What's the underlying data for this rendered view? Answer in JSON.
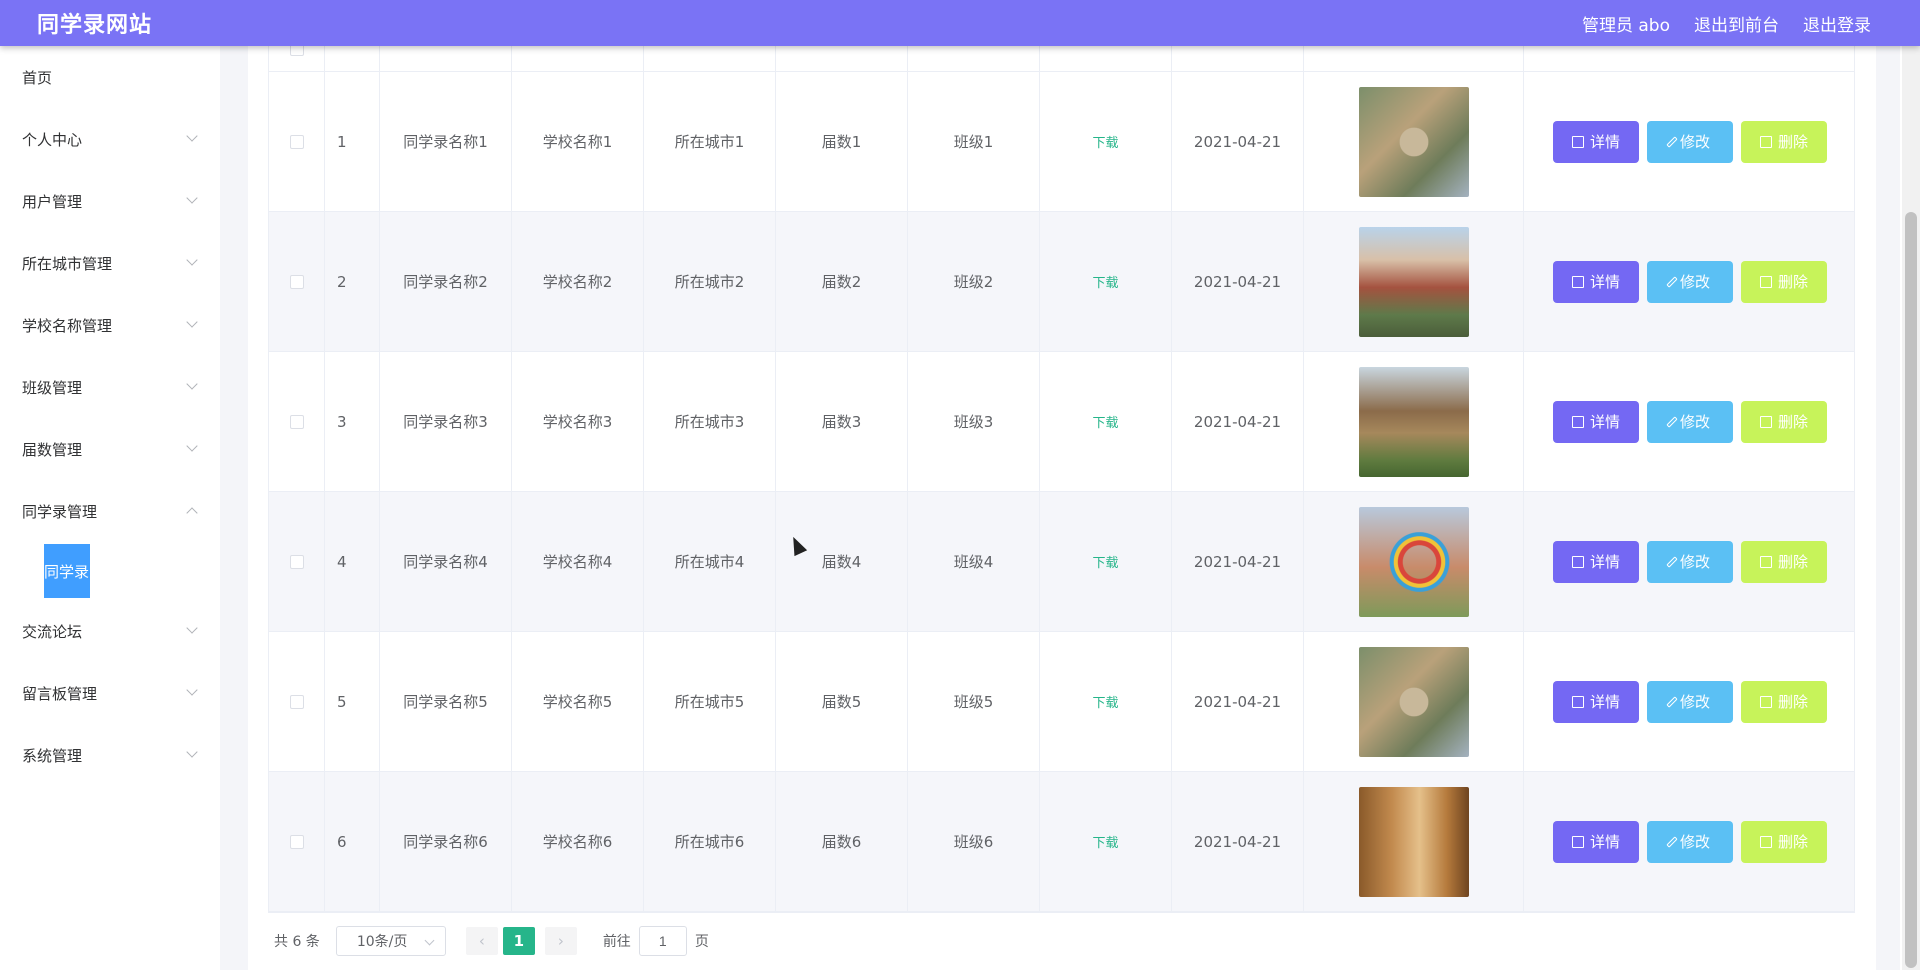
{
  "header": {
    "title": "同学录网站",
    "admin_label": "管理员 abo",
    "front_label": "退出到前台",
    "logout_label": "退出登录"
  },
  "sidebar": {
    "items": [
      {
        "label": "首页",
        "expandable": false
      },
      {
        "label": "个人中心",
        "expandable": true
      },
      {
        "label": "用户管理",
        "expandable": true
      },
      {
        "label": "所在城市管理",
        "expandable": true
      },
      {
        "label": "学校名称管理",
        "expandable": true
      },
      {
        "label": "班级管理",
        "expandable": true
      },
      {
        "label": "届数管理",
        "expandable": true
      },
      {
        "label": "同学录管理",
        "expandable": true,
        "expanded": true
      },
      {
        "label": "交流论坛",
        "expandable": true
      },
      {
        "label": "留言板管理",
        "expandable": true
      },
      {
        "label": "系统管理",
        "expandable": true
      }
    ],
    "submenu_active": "同学录"
  },
  "table": {
    "rows": [
      {
        "index": "1",
        "name": "同学录名称1",
        "school": "学校名称1",
        "city": "所在城市1",
        "year": "届数1",
        "class": "班级1",
        "download": "下载",
        "date": "2021-04-21",
        "image": "campus-aerial-image"
      },
      {
        "index": "2",
        "name": "同学录名称2",
        "school": "学校名称2",
        "city": "所在城市2",
        "year": "届数2",
        "class": "班级2",
        "download": "下载",
        "date": "2021-04-21",
        "image": "school-building-image"
      },
      {
        "index": "3",
        "name": "同学录名称3",
        "school": "学校名称3",
        "city": "所在城市3",
        "year": "届数3",
        "class": "班级3",
        "download": "下载",
        "date": "2021-04-21",
        "image": "pavilion-image"
      },
      {
        "index": "4",
        "name": "同学录名称4",
        "school": "学校名称4",
        "city": "所在城市4",
        "year": "届数4",
        "class": "班级4",
        "download": "下载",
        "date": "2021-04-21",
        "image": "sculpture-image"
      },
      {
        "index": "5",
        "name": "同学录名称5",
        "school": "学校名称5",
        "city": "所在城市5",
        "year": "届数5",
        "class": "班级5",
        "download": "下载",
        "date": "2021-04-21",
        "image": "campus-aerial-image"
      },
      {
        "index": "6",
        "name": "同学录名称6",
        "school": "学校名称6",
        "city": "所在城市6",
        "year": "届数6",
        "class": "班级6",
        "download": "下载",
        "date": "2021-04-21",
        "image": "dorm-room-image"
      }
    ],
    "actions": {
      "detail": "详情",
      "edit": "修改",
      "delete": "删除"
    }
  },
  "pagination": {
    "total_label": "共 6 条",
    "page_size": "10条/页",
    "prev_icon": "chevron-left-icon",
    "next_icon": "chevron-right-icon",
    "current_page": "1",
    "goto_prefix": "前往",
    "goto_value": "1",
    "goto_suffix": "页"
  },
  "colors": {
    "header": "#7a73f5",
    "detail_button": "#7468f3",
    "edit_button": "#5bc0f4",
    "delete_button": "#c7f35a",
    "accent_green": "#26b58a",
    "submenu_active": "#409eff"
  }
}
